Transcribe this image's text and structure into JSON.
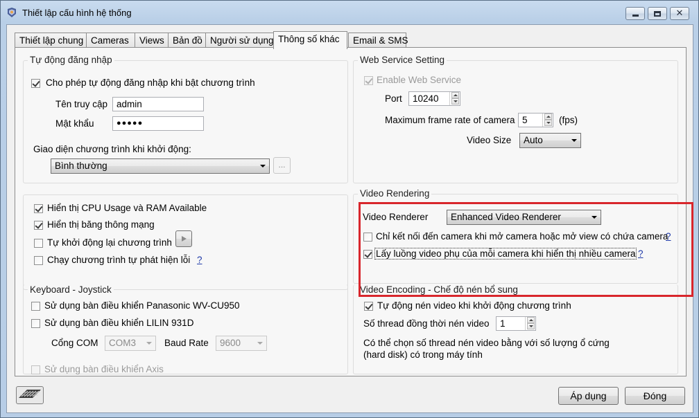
{
  "window": {
    "title": "Thiết lập cấu hình hệ thống"
  },
  "tabs": [
    "Thiết lập chung",
    "Cameras",
    "Views",
    "Bản đồ",
    "Người sử dụng",
    "Thông số khác",
    "Email & SMS"
  ],
  "auto_login": {
    "group_title": "Tự động đăng nhập",
    "enable_label": "Cho phép tự động đăng nhập khi bật chương trình",
    "username_label": "Tên truy cập",
    "username_value": "admin",
    "password_label": "Mật khẩu",
    "password_mask": "●●●●●",
    "startup_ui_label": "Giao diện chương trình khi khởi động:",
    "startup_ui_value": "Bình thường",
    "browse_label": "..."
  },
  "misc": {
    "show_cpu": "Hiển thị CPU Usage và RAM Available",
    "show_bandwidth": "Hiển thị băng thông mạng",
    "auto_restart": "Tự khởi động lại chương trình",
    "auto_detect_error": "Chạy chương trình tự phát hiện lỗi",
    "help": "?"
  },
  "keyboard": {
    "group_title": "Keyboard - Joystick",
    "panasonic": "Sử dụng bàn điều khiển Panasonic WV-CU950",
    "lilin": "Sử dụng bàn điều khiển LILIN 931D",
    "com_label": "Cổng COM",
    "com_value": "COM3",
    "baud_label": "Baud Rate",
    "baud_value": "9600",
    "axis": "Sử dụng bàn điều khiển Axis"
  },
  "web_service": {
    "group_title": "Web Service Setting",
    "enable_label": "Enable Web Service",
    "port_label": "Port",
    "port_value": "10240",
    "max_fps_label": "Maximum frame rate of camera",
    "max_fps_value": "5",
    "fps_unit": "(fps)",
    "video_size_label": "Video Size",
    "video_size_value": "Auto"
  },
  "video_rendering": {
    "group_title": "Video Rendering",
    "renderer_label": "Video Renderer",
    "renderer_value": "Enhanced Video Renderer",
    "connect_on_open": "Chỉ kết nối đến camera khi mở camera hoặc mở view có chứa camera",
    "sub_stream": "Lấy luồng video phụ của mỗi camera khi hiển thị nhiều camera",
    "help": "?"
  },
  "video_encoding": {
    "group_title": "Video Encoding - Chế độ nén bổ sung",
    "auto_compress": "Tự động nén video khi khởi động chương trình",
    "threads_label": "Số thread đồng thời nén video",
    "threads_value": "1",
    "note_line1": "Có thể chọn số thread nén video bằng với số lượng ổ cứng",
    "note_line2": "(hard disk) có trong máy tính"
  },
  "footer": {
    "apply": "Áp dụng",
    "close": "Đóng"
  },
  "colors": {
    "highlight_border": "#d8262c",
    "help_link": "#1f3aa8"
  }
}
